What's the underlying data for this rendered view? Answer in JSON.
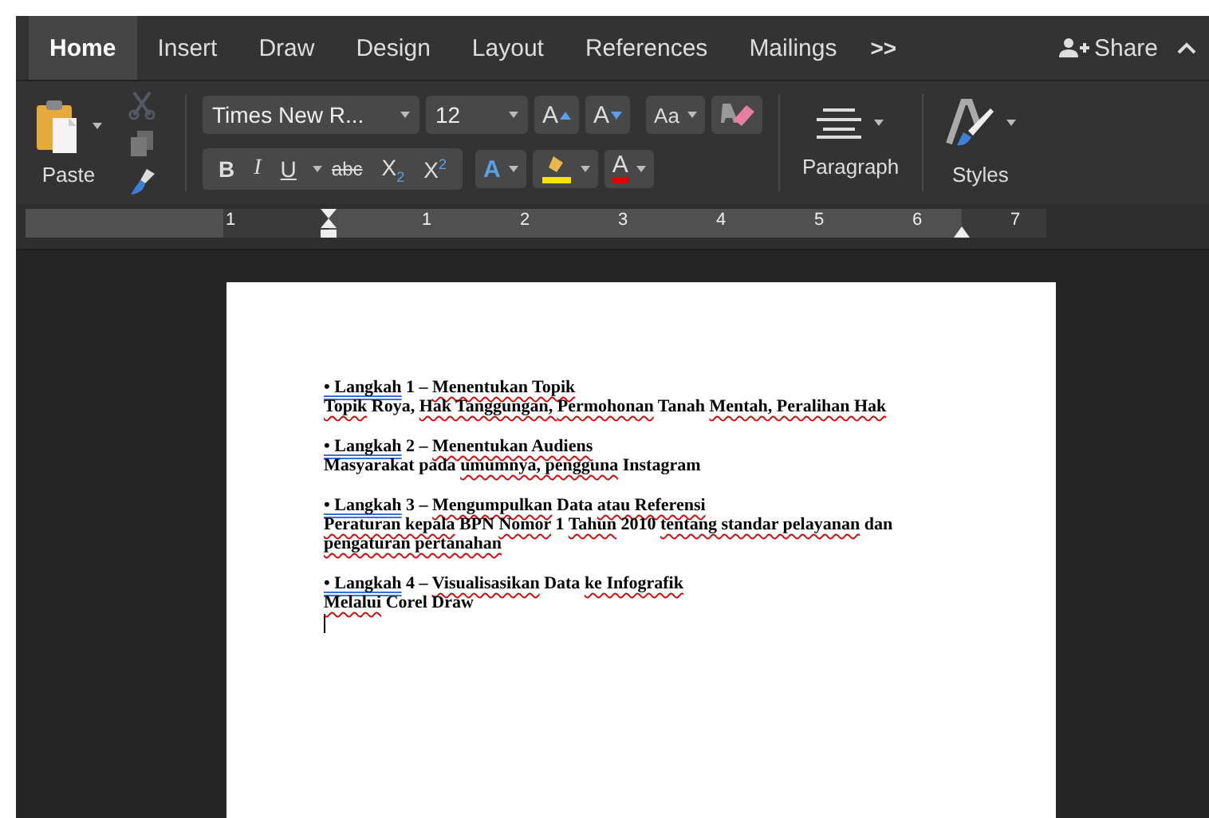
{
  "tabs": [
    {
      "label": "Home",
      "selected": true
    },
    {
      "label": "Insert",
      "selected": false
    },
    {
      "label": "Draw",
      "selected": false
    },
    {
      "label": "Design",
      "selected": false
    },
    {
      "label": "Layout",
      "selected": false
    },
    {
      "label": "References",
      "selected": false
    },
    {
      "label": "Mailings",
      "selected": false
    }
  ],
  "more_tabs": ">>",
  "share": {
    "label": "Share"
  },
  "ribbon": {
    "paste": {
      "label": "Paste"
    },
    "clipboard_tools": [
      {
        "kind": "cut",
        "disabled": true
      },
      {
        "kind": "copy",
        "disabled": true
      },
      {
        "kind": "format_painter",
        "disabled": false
      }
    ],
    "font": {
      "name": "Times New R...",
      "size": "12"
    },
    "size_buttons": [
      {
        "kind": "grow",
        "label": "A"
      },
      {
        "kind": "shrink",
        "label": "A"
      },
      {
        "kind": "case",
        "label": "Aa"
      },
      {
        "kind": "clear"
      }
    ],
    "format_buttons": [
      {
        "kind": "bold",
        "label": "B"
      },
      {
        "kind": "italic",
        "label": "I"
      },
      {
        "kind": "underline",
        "label": "U"
      },
      {
        "kind": "strike",
        "label": "abc"
      },
      {
        "kind": "sub",
        "label": "X$_{2}$"
      },
      {
        "kind": "sup",
        "label": "X$^{2}$"
      }
    ],
    "effects": {
      "label": "A"
    },
    "highlight": {
      "color": "#f2e600"
    },
    "font_color": {
      "label": "A",
      "color": "#e00000"
    },
    "paragraph": {
      "label": "Paragraph"
    },
    "styles": {
      "label": "Styles"
    }
  },
  "ruler": {
    "labels": [
      "1",
      "1",
      "2",
      "3",
      "4",
      "5",
      "6",
      "7"
    ]
  },
  "document": {
    "paragraphs": [
      {
        "lines": [
          [
            {
              "text": "• Langkah",
              "grammar_error": true
            },
            {
              "text": " 1 – "
            },
            {
              "text": "Menentukan Topik",
              "spelling_error": true
            }
          ],
          [
            {
              "text": "Topik",
              "spelling_error": true
            },
            {
              "text": " Roya, "
            },
            {
              "text": "Hak Tanggungan, ",
              "spelling_error": true
            },
            {
              "text": "Permohonan",
              "spelling_error": true
            },
            {
              "text": " Tanah "
            },
            {
              "text": "Mentah, Peralihan Hak",
              "spelling_error": true
            }
          ]
        ]
      },
      {
        "lines": [
          [
            {
              "text": "• Langkah",
              "grammar_error": true
            },
            {
              "text": " 2 – "
            },
            {
              "text": "Menentukan Audiens",
              "spelling_error": true
            }
          ],
          [
            {
              "text": "Masyarakat pada "
            },
            {
              "text": "umumnya, pengguna",
              "spelling_error": true
            },
            {
              "text": " Instagram"
            }
          ]
        ]
      },
      {
        "lines": [
          [
            {
              "text": "• Langkah",
              "grammar_error": true
            },
            {
              "text": " 3 – "
            },
            {
              "text": "Mengumpulkan",
              "spelling_error": true
            },
            {
              "text": " Data "
            },
            {
              "text": "atau Referensi",
              "spelling_error": true
            }
          ],
          [
            {
              "text": "Peraturan kepala",
              "spelling_error": true
            },
            {
              "text": " BPN "
            },
            {
              "text": "Nomor",
              "spelling_error": true
            },
            {
              "text": " 1 "
            },
            {
              "text": "Tahun",
              "spelling_error": true
            },
            {
              "text": " 2010 "
            },
            {
              "text": "tentang standar pelayanan",
              "spelling_error": true
            },
            {
              "text": " dan "
            },
            {
              "text": "pengaturan pertanahan",
              "spelling_error": true
            }
          ]
        ]
      },
      {
        "lines": [
          [
            {
              "text": "• Langkah",
              "grammar_error": true
            },
            {
              "text": " 4 – "
            },
            {
              "text": "Visualisasikan",
              "spelling_error": true
            },
            {
              "text": " Data "
            },
            {
              "text": "ke Infografik",
              "spelling_error": true
            }
          ],
          [
            {
              "text": "Melalui",
              "spelling_error": true
            },
            {
              "text": " Corel Draw"
            }
          ]
        ]
      }
    ],
    "cursor": true
  }
}
